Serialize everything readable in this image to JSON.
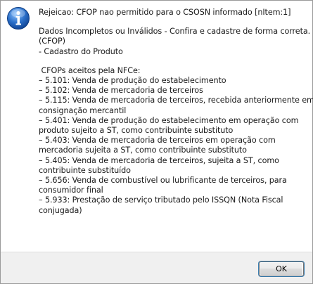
{
  "dialog": {
    "icon": "information-icon",
    "accent_color": "#2a6fc9",
    "title_line": "Rejeicao: CFOP nao permitido para o CSOSN informado [nItem:1]",
    "details": [
      "Dados Incompletos ou Inválidos - Confira e cadastre de forma correta.",
      "(CFOP)",
      "- Cadastro do Produto"
    ],
    "cfop_lines": [
      " CFOPs aceitos pela NFCe:",
      "– 5.101: Venda de produção do estabelecimento",
      "– 5.102: Venda de mercadoria de terceiros",
      "– 5.115: Venda de mercadoria de terceiros, recebida anteriormente em",
      "consignação mercantil",
      "– 5.401: Venda de produção do estabelecimento em operação com",
      "produto sujeito a ST, como contribuinte substituto",
      "– 5.403: Venda de mercadoria de terceiros em operação com",
      "mercadoria sujeita a ST, como contribuinte substituto",
      "– 5.405: Venda de mercadoria de terceiros, sujeita a ST, como",
      "contribuinte substituído",
      "– 5.656: Venda de combustível ou lubrificante de terceiros, para",
      "consumidor final",
      "– 5.933: Prestação de serviço tributado pelo ISSQN (Nota Fiscal",
      "conjugada)"
    ],
    "ok_label": "OK"
  }
}
